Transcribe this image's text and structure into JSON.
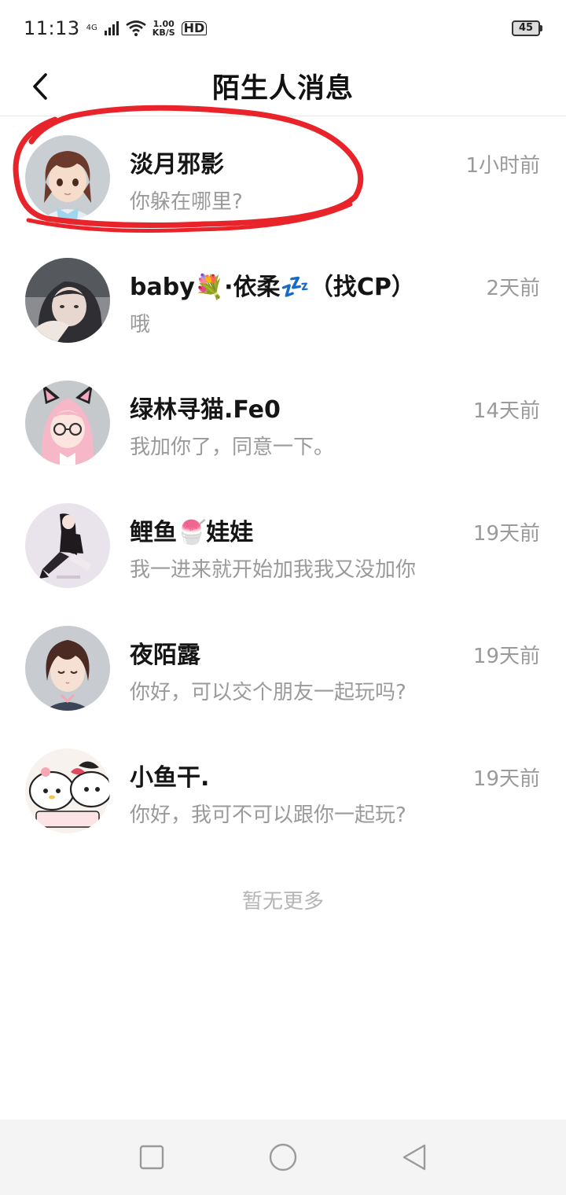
{
  "status_bar": {
    "time": "11:13",
    "network": "4G",
    "speed_value": "1.00",
    "speed_unit": "KB/S",
    "hd": "HD",
    "battery": "45"
  },
  "header": {
    "title": "陌生人消息",
    "back_icon": "chevron-left-icon"
  },
  "messages": [
    {
      "name": "淡月邪影",
      "preview": "你躲在哪里?",
      "time": "1小时前",
      "highlighted": true
    },
    {
      "name": "baby💐·依柔💤（找CP）",
      "preview": "哦",
      "time": "2天前"
    },
    {
      "name": "绿林寻猫.Fe0",
      "preview": "我加你了，同意一下。",
      "time": "14天前"
    },
    {
      "name": "鲤鱼🍧娃娃",
      "preview": "我一进来就开始加我我又没加你",
      "time": "19天前"
    },
    {
      "name": "夜陌露",
      "preview": "你好，可以交个朋友一起玩吗?",
      "time": "19天前"
    },
    {
      "name": "小鱼干.",
      "preview": "你好，我可不可以跟你一起玩?",
      "time": "19天前"
    }
  ],
  "footer_text": "暂无更多",
  "nav_bar": {
    "recent_icon": "square-icon",
    "home_icon": "circle-icon",
    "back_icon": "triangle-back-icon"
  },
  "colors": {
    "annotation": "#e8242a",
    "secondary_text": "#9a9a9a",
    "divider": "#e6e6e6"
  }
}
